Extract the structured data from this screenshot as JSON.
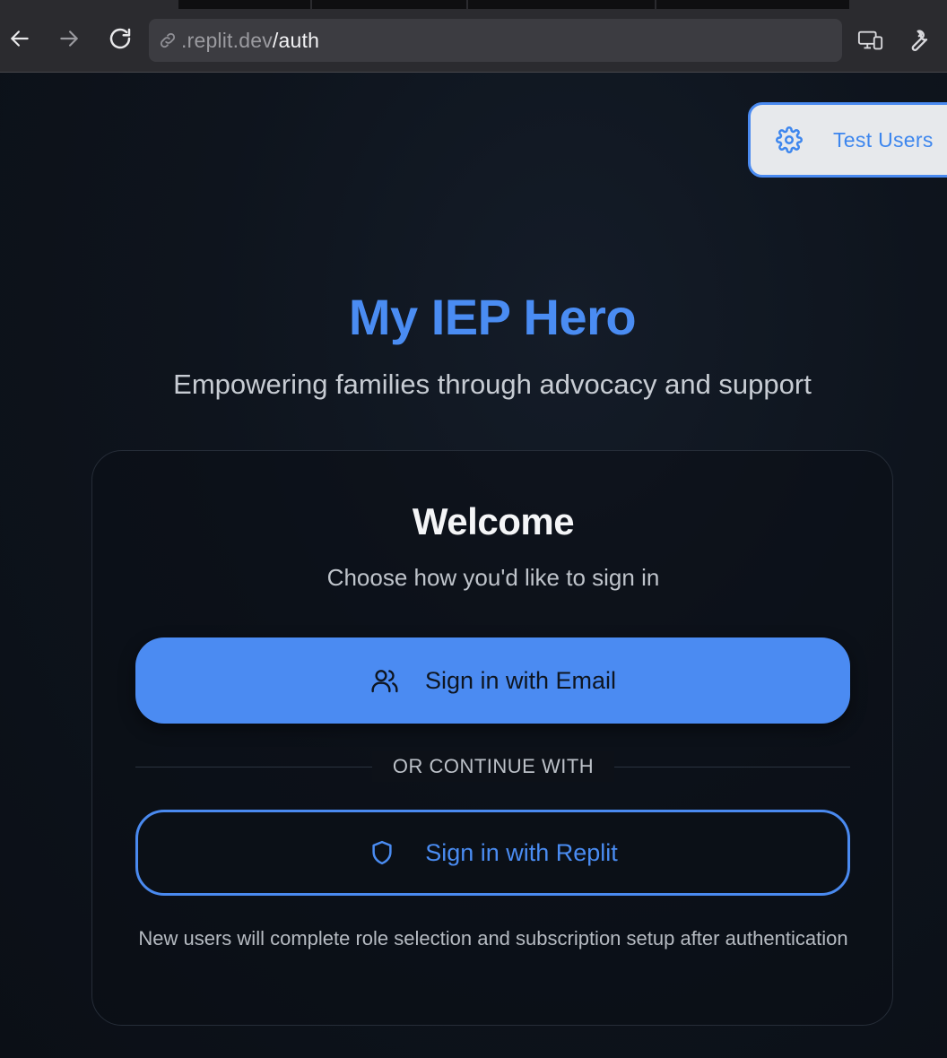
{
  "browser": {
    "url_host": ".replit.dev",
    "url_path": "/auth"
  },
  "icons": {
    "back": "arrow-left-icon",
    "forward": "arrow-right-icon",
    "reload": "reload-icon",
    "link": "link-icon",
    "devices": "devices-icon",
    "wrench": "wrench-icon",
    "settings": "gear-icon",
    "email": "users-icon",
    "replit": "shield-icon"
  },
  "test_users": {
    "label": "Test Users"
  },
  "header": {
    "title": "My IEP Hero",
    "subtitle": "Empowering families through advocacy and support"
  },
  "card": {
    "title": "Welcome",
    "subtitle": "Choose how you'd like to sign in",
    "email_button": "Sign in with Email",
    "divider": "OR CONTINUE WITH",
    "replit_button": "Sign in with Replit",
    "footnote": "New users will complete role selection and subscription setup after authentication"
  },
  "colors": {
    "accent": "#4a8cf2",
    "background": "#0e131b",
    "chrome": "#2b2b2f"
  }
}
